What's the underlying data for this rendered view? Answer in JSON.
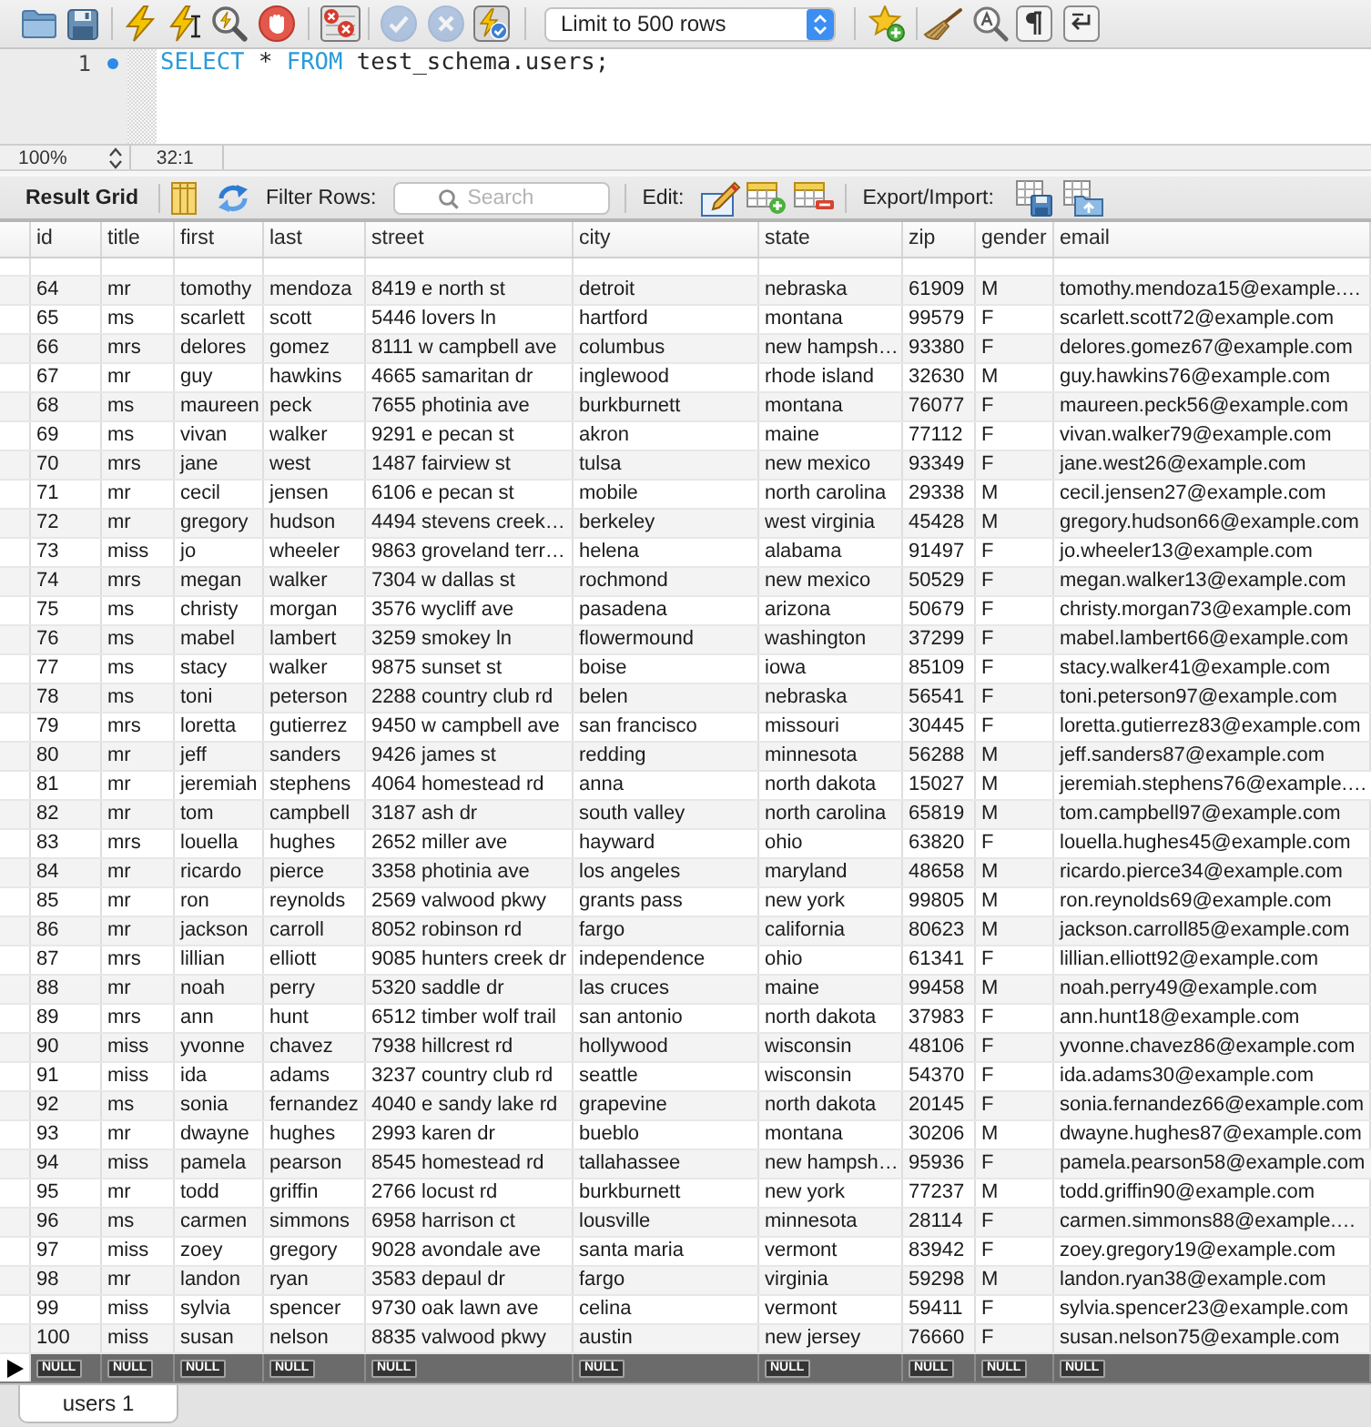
{
  "toolbar": {
    "transaction_buttons": [
      {
        "disabled": true
      },
      {
        "disabled": true
      },
      {
        "disabled": false
      }
    ],
    "limit_select": {
      "value": "Limit to 500 rows"
    }
  },
  "editor": {
    "lines": [
      {
        "number": "1",
        "tokens": [
          {
            "text": "SELECT",
            "kind": "keyword"
          },
          {
            "text": " * ",
            "kind": "plain"
          },
          {
            "text": "FROM",
            "kind": "keyword"
          },
          {
            "text": " test_schema.users;",
            "kind": "plain"
          }
        ]
      }
    ],
    "zoom": "100%",
    "cursor_position": "32:1"
  },
  "result_toolbar": {
    "title": "Result Grid",
    "filter_label": "Filter Rows:",
    "search": {
      "placeholder": "Search"
    },
    "edit_label": "Edit:",
    "export_import_label": "Export/Import:"
  },
  "table": {
    "columns": [
      "id",
      "title",
      "first",
      "last",
      "street",
      "city",
      "state",
      "zip",
      "gender",
      "email"
    ],
    "rows": [
      {
        "cells": [
          "64",
          "mr",
          "tomothy",
          "mendoza",
          "8419 e north st",
          "detroit",
          "nebraska",
          "61909",
          "M",
          "tomothy.mendoza15@example.…"
        ],
        "selected": false
      },
      {
        "cells": [
          "65",
          "ms",
          "scarlett",
          "scott",
          "5446 lovers ln",
          "hartford",
          "montana",
          "99579",
          "F",
          "scarlett.scott72@example.com"
        ],
        "selected": false
      },
      {
        "cells": [
          "66",
          "mrs",
          "delores",
          "gomez",
          "8111 w campbell ave",
          "columbus",
          "new hampsh…",
          "93380",
          "F",
          "delores.gomez67@example.com"
        ],
        "selected": false
      },
      {
        "cells": [
          "67",
          "mr",
          "guy",
          "hawkins",
          "4665 samaritan dr",
          "inglewood",
          "rhode island",
          "32630",
          "M",
          "guy.hawkins76@example.com"
        ],
        "selected": false
      },
      {
        "cells": [
          "68",
          "ms",
          "maureen",
          "peck",
          "7655 photinia ave",
          "burkburnett",
          "montana",
          "76077",
          "F",
          "maureen.peck56@example.com"
        ],
        "selected": false
      },
      {
        "cells": [
          "69",
          "ms",
          "vivan",
          "walker",
          "9291 e pecan st",
          "akron",
          "maine",
          "77112",
          "F",
          "vivan.walker79@example.com"
        ],
        "selected": false
      },
      {
        "cells": [
          "70",
          "mrs",
          "jane",
          "west",
          "1487 fairview st",
          "tulsa",
          "new mexico",
          "93349",
          "F",
          "jane.west26@example.com"
        ],
        "selected": false
      },
      {
        "cells": [
          "71",
          "mr",
          "cecil",
          "jensen",
          "6106 e pecan st",
          "mobile",
          "north carolina",
          "29338",
          "M",
          "cecil.jensen27@example.com"
        ],
        "selected": false
      },
      {
        "cells": [
          "72",
          "mr",
          "gregory",
          "hudson",
          "4494 stevens creek…",
          "berkeley",
          "west virginia",
          "45428",
          "M",
          "gregory.hudson66@example.com"
        ],
        "selected": false
      },
      {
        "cells": [
          "73",
          "miss",
          "jo",
          "wheeler",
          "9863 groveland terr…",
          "helena",
          "alabama",
          "91497",
          "F",
          "jo.wheeler13@example.com"
        ],
        "selected": false
      },
      {
        "cells": [
          "74",
          "mrs",
          "megan",
          "walker",
          "7304 w dallas st",
          "rochmond",
          "new mexico",
          "50529",
          "F",
          "megan.walker13@example.com"
        ],
        "selected": false
      },
      {
        "cells": [
          "75",
          "ms",
          "christy",
          "morgan",
          "3576 wycliff ave",
          "pasadena",
          "arizona",
          "50679",
          "F",
          "christy.morgan73@example.com"
        ],
        "selected": false
      },
      {
        "cells": [
          "76",
          "ms",
          "mabel",
          "lambert",
          "3259 smokey ln",
          "flowermound",
          "washington",
          "37299",
          "F",
          "mabel.lambert66@example.com"
        ],
        "selected": false
      },
      {
        "cells": [
          "77",
          "ms",
          "stacy",
          "walker",
          "9875 sunset st",
          "boise",
          "iowa",
          "85109",
          "F",
          "stacy.walker41@example.com"
        ],
        "selected": false
      },
      {
        "cells": [
          "78",
          "ms",
          "toni",
          "peterson",
          "2288 country club rd",
          "belen",
          "nebraska",
          "56541",
          "F",
          "toni.peterson97@example.com"
        ],
        "selected": false
      },
      {
        "cells": [
          "79",
          "mrs",
          "loretta",
          "gutierrez",
          "9450 w campbell ave",
          "san francisco",
          "missouri",
          "30445",
          "F",
          "loretta.gutierrez83@example.com"
        ],
        "selected": false
      },
      {
        "cells": [
          "80",
          "mr",
          "jeff",
          "sanders",
          "9426 james st",
          "redding",
          "minnesota",
          "56288",
          "M",
          "jeff.sanders87@example.com"
        ],
        "selected": false
      },
      {
        "cells": [
          "81",
          "mr",
          "jeremiah",
          "stephens",
          "4064 homestead rd",
          "anna",
          "north dakota",
          "15027",
          "M",
          "jeremiah.stephens76@example.…"
        ],
        "selected": false
      },
      {
        "cells": [
          "82",
          "mr",
          "tom",
          "campbell",
          "3187 ash dr",
          "south valley",
          "north carolina",
          "65819",
          "M",
          "tom.campbell97@example.com"
        ],
        "selected": false
      },
      {
        "cells": [
          "83",
          "mrs",
          "louella",
          "hughes",
          "2652 miller ave",
          "hayward",
          "ohio",
          "63820",
          "F",
          "louella.hughes45@example.com"
        ],
        "selected": false
      },
      {
        "cells": [
          "84",
          "mr",
          "ricardo",
          "pierce",
          "3358 photinia ave",
          "los angeles",
          "maryland",
          "48658",
          "M",
          "ricardo.pierce34@example.com"
        ],
        "selected": false
      },
      {
        "cells": [
          "85",
          "mr",
          "ron",
          "reynolds",
          "2569 valwood pkwy",
          "grants pass",
          "new york",
          "99805",
          "M",
          "ron.reynolds69@example.com"
        ],
        "selected": false
      },
      {
        "cells": [
          "86",
          "mr",
          "jackson",
          "carroll",
          "8052 robinson rd",
          "fargo",
          "california",
          "80623",
          "M",
          "jackson.carroll85@example.com"
        ],
        "selected": false
      },
      {
        "cells": [
          "87",
          "mrs",
          "lillian",
          "elliott",
          "9085 hunters creek dr",
          "independence",
          "ohio",
          "61341",
          "F",
          "lillian.elliott92@example.com"
        ],
        "selected": false
      },
      {
        "cells": [
          "88",
          "mr",
          "noah",
          "perry",
          "5320 saddle dr",
          "las cruces",
          "maine",
          "99458",
          "M",
          "noah.perry49@example.com"
        ],
        "selected": false
      },
      {
        "cells": [
          "89",
          "mrs",
          "ann",
          "hunt",
          "6512 timber wolf trail",
          "san antonio",
          "north dakota",
          "37983",
          "F",
          "ann.hunt18@example.com"
        ],
        "selected": false
      },
      {
        "cells": [
          "90",
          "miss",
          "yvonne",
          "chavez",
          "7938 hillcrest rd",
          "hollywood",
          "wisconsin",
          "48106",
          "F",
          "yvonne.chavez86@example.com"
        ],
        "selected": false
      },
      {
        "cells": [
          "91",
          "miss",
          "ida",
          "adams",
          "3237 country club rd",
          "seattle",
          "wisconsin",
          "54370",
          "F",
          "ida.adams30@example.com"
        ],
        "selected": false
      },
      {
        "cells": [
          "92",
          "ms",
          "sonia",
          "fernandez",
          "4040 e sandy lake rd",
          "grapevine",
          "north dakota",
          "20145",
          "F",
          "sonia.fernandez66@example.com"
        ],
        "selected": false
      },
      {
        "cells": [
          "93",
          "mr",
          "dwayne",
          "hughes",
          "2993 karen dr",
          "bueblo",
          "montana",
          "30206",
          "M",
          "dwayne.hughes87@example.com"
        ],
        "selected": false
      },
      {
        "cells": [
          "94",
          "miss",
          "pamela",
          "pearson",
          "8545 homestead rd",
          "tallahassee",
          "new hampsh…",
          "95936",
          "F",
          "pamela.pearson58@example.com"
        ],
        "selected": false
      },
      {
        "cells": [
          "95",
          "mr",
          "todd",
          "griffin",
          "2766 locust rd",
          "burkburnett",
          "new york",
          "77237",
          "M",
          "todd.griffin90@example.com"
        ],
        "selected": false
      },
      {
        "cells": [
          "96",
          "ms",
          "carmen",
          "simmons",
          "6958 harrison ct",
          "lousville",
          "minnesota",
          "28114",
          "F",
          "carmen.simmons88@example.…"
        ],
        "selected": false
      },
      {
        "cells": [
          "97",
          "miss",
          "zoey",
          "gregory",
          "9028 avondale ave",
          "santa maria",
          "vermont",
          "83942",
          "F",
          "zoey.gregory19@example.com"
        ],
        "selected": false
      },
      {
        "cells": [
          "98",
          "mr",
          "landon",
          "ryan",
          "3583 depaul dr",
          "fargo",
          "virginia",
          "59298",
          "M",
          "landon.ryan38@example.com"
        ],
        "selected": false
      },
      {
        "cells": [
          "99",
          "miss",
          "sylvia",
          "spencer",
          "9730 oak lawn ave",
          "celina",
          "vermont",
          "59411",
          "F",
          "sylvia.spencer23@example.com"
        ],
        "selected": false
      },
      {
        "cells": [
          "100",
          "miss",
          "susan",
          "nelson",
          "8835 valwood pkwy",
          "austin",
          "new jersey",
          "76660",
          "F",
          "susan.nelson75@example.com"
        ],
        "selected": false
      }
    ],
    "new_row": {
      "cells": [
        "NULL",
        "NULL",
        "NULL",
        "NULL",
        "NULL",
        "NULL",
        "NULL",
        "NULL",
        "NULL",
        "NULL"
      ],
      "selected": true
    }
  },
  "result_tabs": [
    {
      "label": "users 1",
      "selected": true
    }
  ]
}
